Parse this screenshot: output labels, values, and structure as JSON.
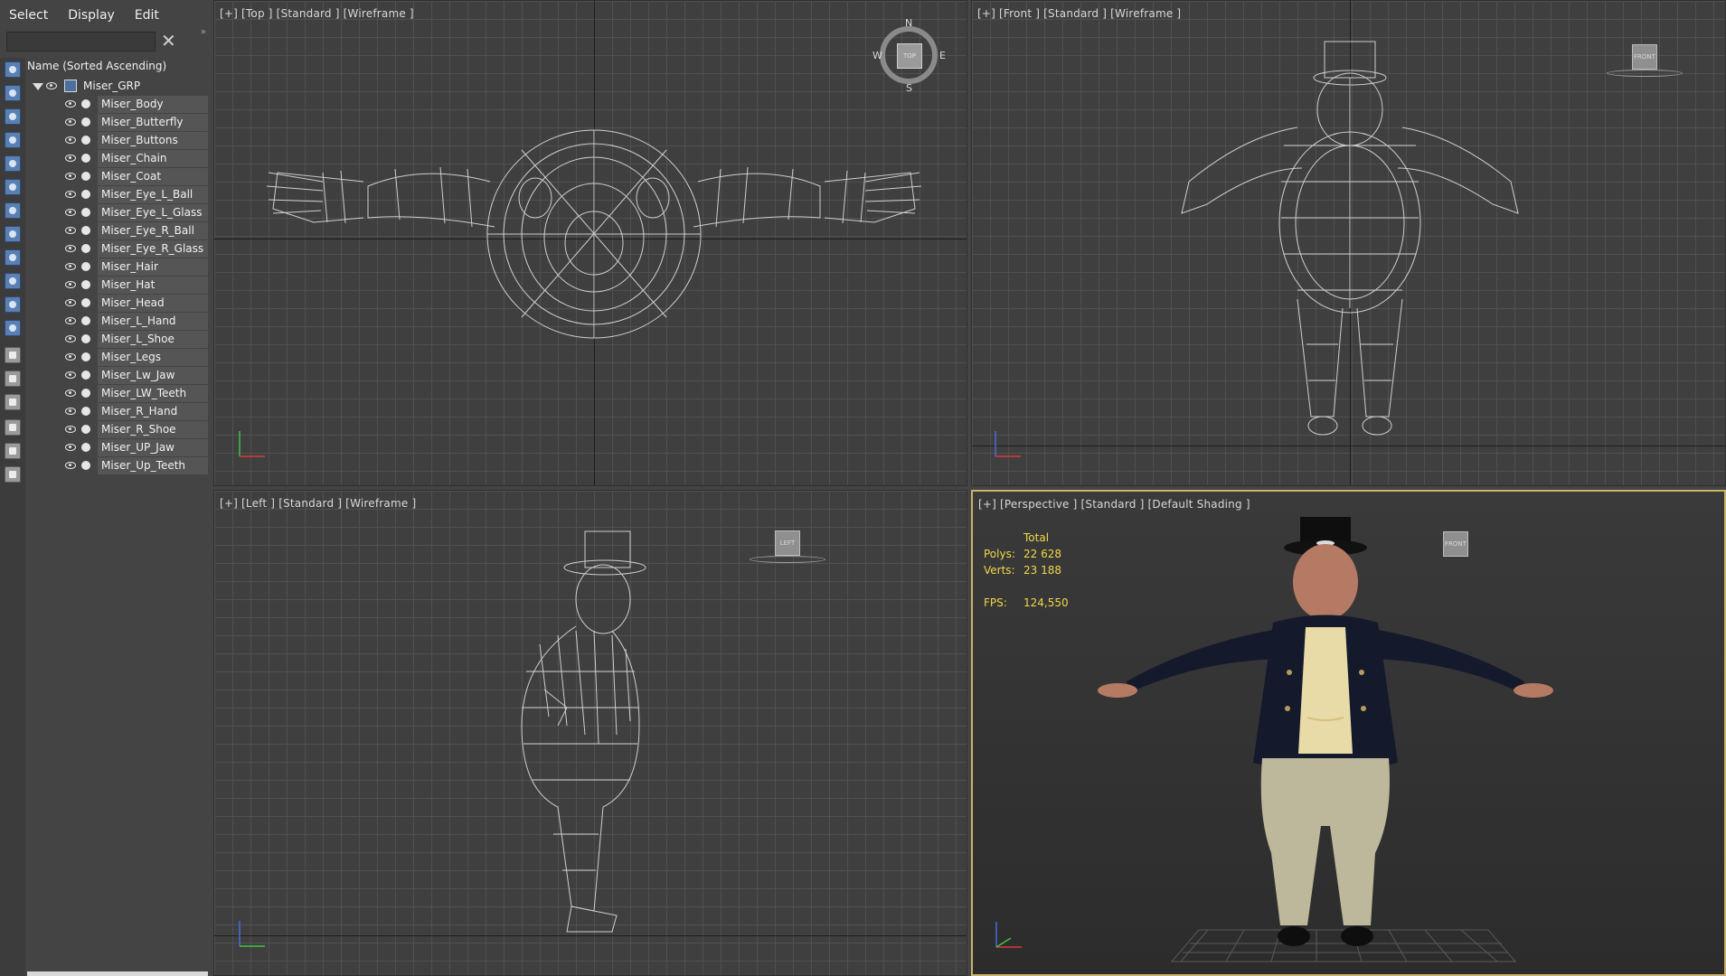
{
  "menu": {
    "select": "Select",
    "display": "Display",
    "edit": "Edit"
  },
  "search": {
    "value": "",
    "placeholder": ""
  },
  "explorer": {
    "column_header": "Name (Sorted Ascending)",
    "group": "Miser_GRP",
    "items": [
      "Miser_Body",
      "Miser_Butterfly",
      "Miser_Buttons",
      "Miser_Chain",
      "Miser_Coat",
      "Miser_Eye_L_Ball",
      "Miser_Eye_L_Glass",
      "Miser_Eye_R_Ball",
      "Miser_Eye_R_Glass",
      "Miser_Hair",
      "Miser_Hat",
      "Miser_Head",
      "Miser_L_Hand",
      "Miser_L_Shoe",
      "Miser_Legs",
      "Miser_Lw_Jaw",
      "Miser_LW_Teeth",
      "Miser_R_Hand",
      "Miser_R_Shoe",
      "Miser_UP_Jaw",
      "Miser_Up_Teeth"
    ]
  },
  "viewports": {
    "top": "[+] [Top ] [Standard ] [Wireframe ]",
    "front": "[+] [Front ] [Standard ] [Wireframe ]",
    "left": "[+] [Left ] [Standard ] [Wireframe ]",
    "perspective": "[+] [Perspective ] [Standard ] [Default Shading ]"
  },
  "compass": {
    "n": "N",
    "s": "S",
    "e": "E",
    "w": "W",
    "cube": "TOP"
  },
  "viewcube": {
    "front": "FRONT",
    "left": "LEFT",
    "persp": "FRONT"
  },
  "stats": {
    "total": "Total",
    "polys_label": "Polys:",
    "polys": "22 628",
    "verts_label": "Verts:",
    "verts": "23 188",
    "fps_label": "FPS:",
    "fps": "124,550"
  },
  "icons": [
    "close-icon",
    "eye-icon",
    "visibility-dot-icon",
    "expand-triangle-icon",
    "group-icon",
    "filter-icon",
    "axis-gizmo-icon"
  ],
  "colors": {
    "accent": "#5a7fb3",
    "active_viewport_border": "#c8b46a",
    "stats_text": "#f0d848"
  }
}
